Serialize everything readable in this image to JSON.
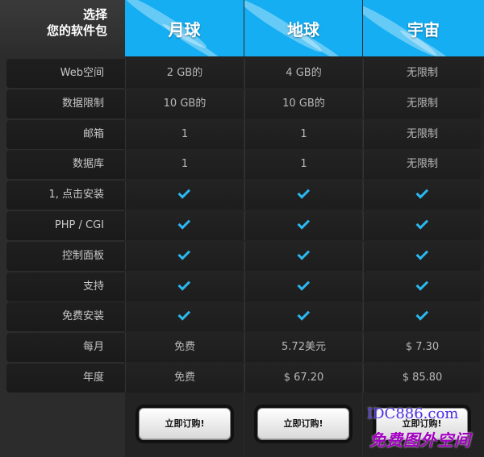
{
  "corner": {
    "line1": "选择",
    "line2": "您的软件包"
  },
  "plans": [
    {
      "name": "月球"
    },
    {
      "name": "地球"
    },
    {
      "name": "宇宙"
    }
  ],
  "rows": [
    {
      "label": "Web空间",
      "values": [
        "2 GB的",
        "4 GB的",
        "无限制"
      ]
    },
    {
      "label": "数据限制",
      "values": [
        "10 GB的",
        "10 GB的",
        "无限制"
      ]
    },
    {
      "label": "邮箱",
      "values": [
        "1",
        "1",
        "无限制"
      ]
    },
    {
      "label": "数据库",
      "values": [
        "1",
        "1",
        "无限制"
      ]
    },
    {
      "label": "1, 点击安装",
      "values": [
        "check",
        "check",
        "check"
      ]
    },
    {
      "label": "PHP / CGI",
      "values": [
        "check",
        "check",
        "check"
      ]
    },
    {
      "label": "控制面板",
      "values": [
        "check",
        "check",
        "check"
      ]
    },
    {
      "label": "支持",
      "values": [
        "check",
        "check",
        "check"
      ]
    },
    {
      "label": "免费安装",
      "values": [
        "check",
        "check",
        "check"
      ]
    },
    {
      "label": "每月",
      "values": [
        "免费",
        "5.72美元",
        "$ 7.30"
      ]
    },
    {
      "label": "年度",
      "values": [
        "免费",
        "$ 67.20",
        "$ 85.80"
      ]
    }
  ],
  "buttons": {
    "order_label": "立即订购!"
  },
  "watermark": {
    "line1": "IDC886.com",
    "line2": "免费图外空间"
  },
  "colors": {
    "header_blue": "#15aef2",
    "check_blue": "#2bb8f0",
    "background": "#2b2b2b"
  }
}
